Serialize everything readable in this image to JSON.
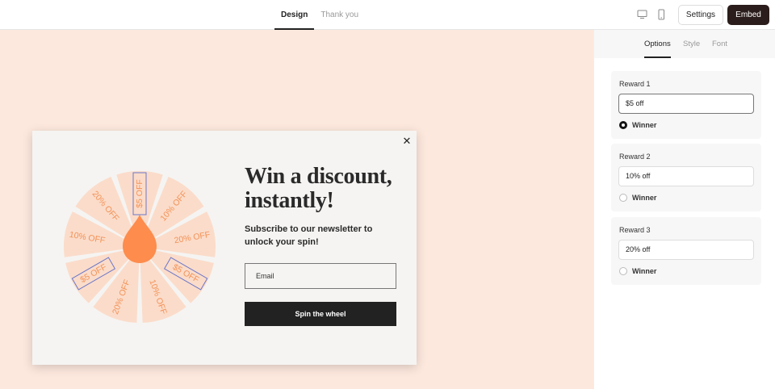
{
  "topbar": {
    "tabs": [
      {
        "label": "Design",
        "active": true
      },
      {
        "label": "Thank you",
        "active": false
      }
    ],
    "settings_label": "Settings",
    "embed_label": "Embed",
    "device_icons": [
      "desktop-icon",
      "mobile-icon"
    ]
  },
  "popup": {
    "headline": "Win a discount, instantly!",
    "subtext": "Subscribe to our newsletter to unlock your spin!",
    "email_placeholder": "Email",
    "button_label": "Spin the wheel",
    "close_icon": "close-icon",
    "wheel": {
      "segments": [
        "$5 OFF",
        "10% OFF",
        "20% OFF",
        "$5 OFF",
        "10% OFF",
        "20% OFF",
        "$5 OFF",
        "10% OFF",
        "20% OFF"
      ],
      "segment_color": "#fbdcca",
      "text_color": "#f39257",
      "pointer_color": "#fd8c4d"
    }
  },
  "panel": {
    "tabs": [
      {
        "label": "Options",
        "active": true
      },
      {
        "label": "Style",
        "active": false
      },
      {
        "label": "Font",
        "active": false
      }
    ],
    "rewards": [
      {
        "label": "Reward 1",
        "value": "$5 off",
        "winner_label": "Winner",
        "winner": true
      },
      {
        "label": "Reward 2",
        "value": "10% off",
        "winner_label": "Winner",
        "winner": false
      },
      {
        "label": "Reward 3",
        "value": "20% off",
        "winner_label": "Winner",
        "winner": false
      }
    ]
  },
  "colors": {
    "canvas_bg": "#fde8dd",
    "accent_dark": "#2b1d1b",
    "highlight_outline": "#6b77c9"
  }
}
